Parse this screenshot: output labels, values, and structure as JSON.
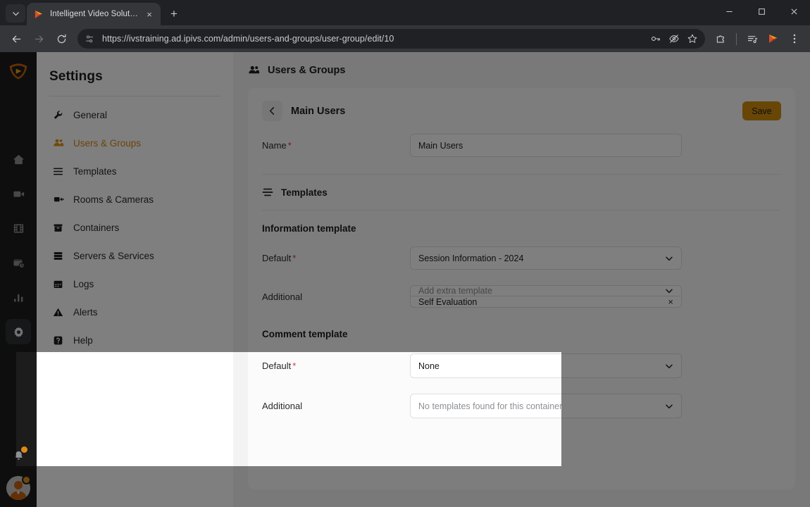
{
  "browser": {
    "tab": {
      "title": "Intelligent Video Solutions",
      "close_label": "×"
    },
    "new_tab_label": "+",
    "tab_list_icon": "chevron-down-icon",
    "window_controls": {
      "minimize": "–",
      "maximize": "□",
      "close": "✕"
    },
    "nav": {
      "back": "←",
      "forward": "→",
      "reload": "⟳"
    },
    "omnibox": {
      "url": "https://ivstraining.ad.ipivs.com/admin/users-and-groups/user-group/edit/10",
      "site_icon": "page-settings-icon",
      "actions": [
        "password-key-icon",
        "eye-slash-icon",
        "bookmark-star-icon"
      ]
    },
    "toolbar_right": [
      "extensions-puzzle-icon",
      "reading-list-icon",
      "ivs-profile-icon",
      "chrome-menu-icon"
    ]
  },
  "rail": {
    "logo": "ivs-shield-logo",
    "items": [
      {
        "name": "home-icon",
        "active": false
      },
      {
        "name": "camera-icon",
        "active": false
      },
      {
        "name": "filmstrip-icon",
        "active": false
      },
      {
        "name": "scheduling-icon",
        "active": false
      },
      {
        "name": "analytics-bar-icon",
        "active": false
      },
      {
        "name": "gear-icon",
        "active": true
      }
    ],
    "notifications": {
      "icon": "bell-icon",
      "has_badge": true
    },
    "account": {
      "icon": "user-avatar",
      "has_badge": true
    }
  },
  "settings_nav": {
    "title": "Settings",
    "items": [
      {
        "label": "General",
        "icon": "wrench-icon",
        "active": false
      },
      {
        "label": "Users & Groups",
        "icon": "users-icon",
        "active": true
      },
      {
        "label": "Templates",
        "icon": "list-lines-icon",
        "active": false
      },
      {
        "label": "Rooms & Cameras",
        "icon": "video-camera-icon",
        "active": false
      },
      {
        "label": "Containers",
        "icon": "box-icon",
        "active": false
      },
      {
        "label": "Servers & Services",
        "icon": "server-icon",
        "active": false
      },
      {
        "label": "Logs",
        "icon": "calendar-icon",
        "active": false
      },
      {
        "label": "Alerts",
        "icon": "warning-triangle-icon",
        "active": false
      },
      {
        "label": "Help",
        "icon": "help-question-icon",
        "active": false
      }
    ]
  },
  "main": {
    "page_header": {
      "title": "Users & Groups",
      "icon": "users-icon"
    },
    "card": {
      "back_icon": "chevron-left-icon",
      "title": "Main Users",
      "save_label": "Save"
    },
    "name_row": {
      "label": "Name",
      "required_marker": "*",
      "value": "Main Users"
    },
    "templates_section": {
      "icon": "templates-icon",
      "heading": "Templates"
    },
    "information_template": {
      "heading": "Information template",
      "default": {
        "label": "Default",
        "required_marker": "*",
        "value": "Session Information - 2024",
        "chevron": "chevron-down-icon"
      },
      "additional": {
        "label": "Additional",
        "placeholder": "Add extra template",
        "chevron": "chevron-down-icon",
        "chips": [
          {
            "label": "Self Evaluation",
            "remove": "×"
          }
        ]
      }
    },
    "comment_template": {
      "heading": "Comment template",
      "highlighted": true,
      "default": {
        "label": "Default",
        "required_marker": "*",
        "value": "None",
        "chevron": "chevron-down-icon"
      },
      "additional": {
        "label": "Additional",
        "placeholder": "No templates found for this container",
        "chevron": "chevron-down-icon"
      }
    }
  },
  "colors": {
    "accent": "#d8880f",
    "save_button": "#d08c0b",
    "required": "#d7373f",
    "rail_bg": "#1c1c1c",
    "main_bg": "#f3f3f4",
    "card_bg": "#fbfbfb"
  }
}
